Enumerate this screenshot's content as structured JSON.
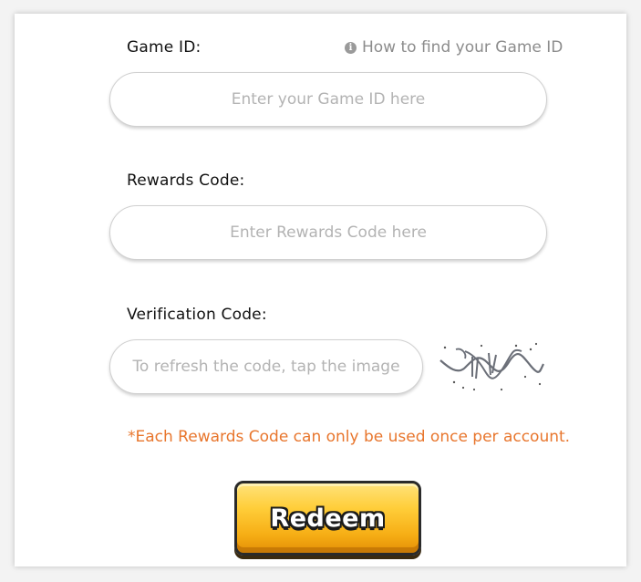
{
  "form": {
    "game_id": {
      "label": "Game ID:",
      "help_text": "How to find your Game ID",
      "placeholder": "Enter your Game ID here",
      "value": ""
    },
    "rewards_code": {
      "label": "Rewards Code:",
      "placeholder": "Enter Rewards Code here",
      "value": ""
    },
    "verification_code": {
      "label": "Verification Code:",
      "placeholder": "To refresh the code, tap the image",
      "value": ""
    },
    "notice": "*Each Rewards Code can only be used once per account.",
    "redeem_label": "Redeem"
  },
  "icons": {
    "help": "info-circle-icon",
    "captcha": "captcha-image"
  },
  "colors": {
    "notice": "#e8762d",
    "button_top": "#ffe27a",
    "button_bottom": "#e38e06",
    "placeholder": "#b3b3b3"
  }
}
